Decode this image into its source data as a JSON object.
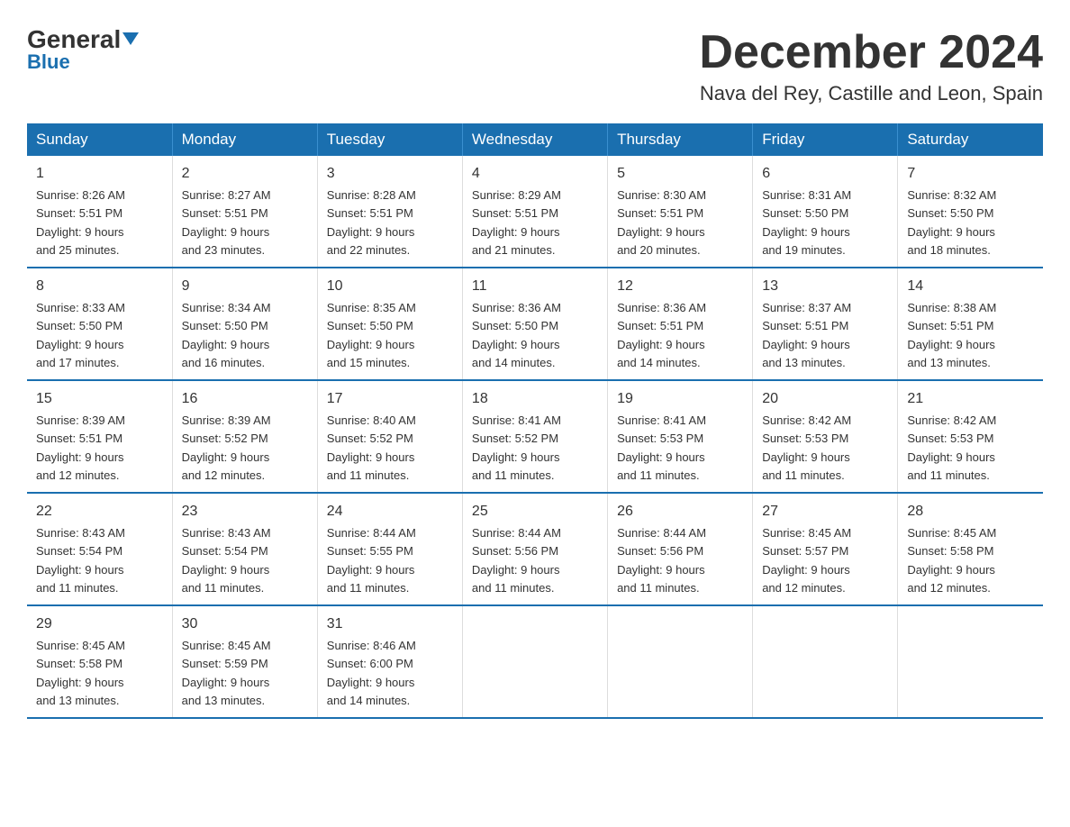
{
  "header": {
    "logo_general": "General",
    "logo_blue": "Blue",
    "month_title": "December 2024",
    "location": "Nava del Rey, Castille and Leon, Spain"
  },
  "days_of_week": [
    "Sunday",
    "Monday",
    "Tuesday",
    "Wednesday",
    "Thursday",
    "Friday",
    "Saturday"
  ],
  "weeks": [
    [
      {
        "day": "1",
        "sunrise": "8:26 AM",
        "sunset": "5:51 PM",
        "daylight": "9 hours and 25 minutes."
      },
      {
        "day": "2",
        "sunrise": "8:27 AM",
        "sunset": "5:51 PM",
        "daylight": "9 hours and 23 minutes."
      },
      {
        "day": "3",
        "sunrise": "8:28 AM",
        "sunset": "5:51 PM",
        "daylight": "9 hours and 22 minutes."
      },
      {
        "day": "4",
        "sunrise": "8:29 AM",
        "sunset": "5:51 PM",
        "daylight": "9 hours and 21 minutes."
      },
      {
        "day": "5",
        "sunrise": "8:30 AM",
        "sunset": "5:51 PM",
        "daylight": "9 hours and 20 minutes."
      },
      {
        "day": "6",
        "sunrise": "8:31 AM",
        "sunset": "5:50 PM",
        "daylight": "9 hours and 19 minutes."
      },
      {
        "day": "7",
        "sunrise": "8:32 AM",
        "sunset": "5:50 PM",
        "daylight": "9 hours and 18 minutes."
      }
    ],
    [
      {
        "day": "8",
        "sunrise": "8:33 AM",
        "sunset": "5:50 PM",
        "daylight": "9 hours and 17 minutes."
      },
      {
        "day": "9",
        "sunrise": "8:34 AM",
        "sunset": "5:50 PM",
        "daylight": "9 hours and 16 minutes."
      },
      {
        "day": "10",
        "sunrise": "8:35 AM",
        "sunset": "5:50 PM",
        "daylight": "9 hours and 15 minutes."
      },
      {
        "day": "11",
        "sunrise": "8:36 AM",
        "sunset": "5:50 PM",
        "daylight": "9 hours and 14 minutes."
      },
      {
        "day": "12",
        "sunrise": "8:36 AM",
        "sunset": "5:51 PM",
        "daylight": "9 hours and 14 minutes."
      },
      {
        "day": "13",
        "sunrise": "8:37 AM",
        "sunset": "5:51 PM",
        "daylight": "9 hours and 13 minutes."
      },
      {
        "day": "14",
        "sunrise": "8:38 AM",
        "sunset": "5:51 PM",
        "daylight": "9 hours and 13 minutes."
      }
    ],
    [
      {
        "day": "15",
        "sunrise": "8:39 AM",
        "sunset": "5:51 PM",
        "daylight": "9 hours and 12 minutes."
      },
      {
        "day": "16",
        "sunrise": "8:39 AM",
        "sunset": "5:52 PM",
        "daylight": "9 hours and 12 minutes."
      },
      {
        "day": "17",
        "sunrise": "8:40 AM",
        "sunset": "5:52 PM",
        "daylight": "9 hours and 11 minutes."
      },
      {
        "day": "18",
        "sunrise": "8:41 AM",
        "sunset": "5:52 PM",
        "daylight": "9 hours and 11 minutes."
      },
      {
        "day": "19",
        "sunrise": "8:41 AM",
        "sunset": "5:53 PM",
        "daylight": "9 hours and 11 minutes."
      },
      {
        "day": "20",
        "sunrise": "8:42 AM",
        "sunset": "5:53 PM",
        "daylight": "9 hours and 11 minutes."
      },
      {
        "day": "21",
        "sunrise": "8:42 AM",
        "sunset": "5:53 PM",
        "daylight": "9 hours and 11 minutes."
      }
    ],
    [
      {
        "day": "22",
        "sunrise": "8:43 AM",
        "sunset": "5:54 PM",
        "daylight": "9 hours and 11 minutes."
      },
      {
        "day": "23",
        "sunrise": "8:43 AM",
        "sunset": "5:54 PM",
        "daylight": "9 hours and 11 minutes."
      },
      {
        "day": "24",
        "sunrise": "8:44 AM",
        "sunset": "5:55 PM",
        "daylight": "9 hours and 11 minutes."
      },
      {
        "day": "25",
        "sunrise": "8:44 AM",
        "sunset": "5:56 PM",
        "daylight": "9 hours and 11 minutes."
      },
      {
        "day": "26",
        "sunrise": "8:44 AM",
        "sunset": "5:56 PM",
        "daylight": "9 hours and 11 minutes."
      },
      {
        "day": "27",
        "sunrise": "8:45 AM",
        "sunset": "5:57 PM",
        "daylight": "9 hours and 12 minutes."
      },
      {
        "day": "28",
        "sunrise": "8:45 AM",
        "sunset": "5:58 PM",
        "daylight": "9 hours and 12 minutes."
      }
    ],
    [
      {
        "day": "29",
        "sunrise": "8:45 AM",
        "sunset": "5:58 PM",
        "daylight": "9 hours and 13 minutes."
      },
      {
        "day": "30",
        "sunrise": "8:45 AM",
        "sunset": "5:59 PM",
        "daylight": "9 hours and 13 minutes."
      },
      {
        "day": "31",
        "sunrise": "8:46 AM",
        "sunset": "6:00 PM",
        "daylight": "9 hours and 14 minutes."
      },
      null,
      null,
      null,
      null
    ]
  ],
  "labels": {
    "sunrise": "Sunrise:",
    "sunset": "Sunset:",
    "daylight": "Daylight:"
  }
}
